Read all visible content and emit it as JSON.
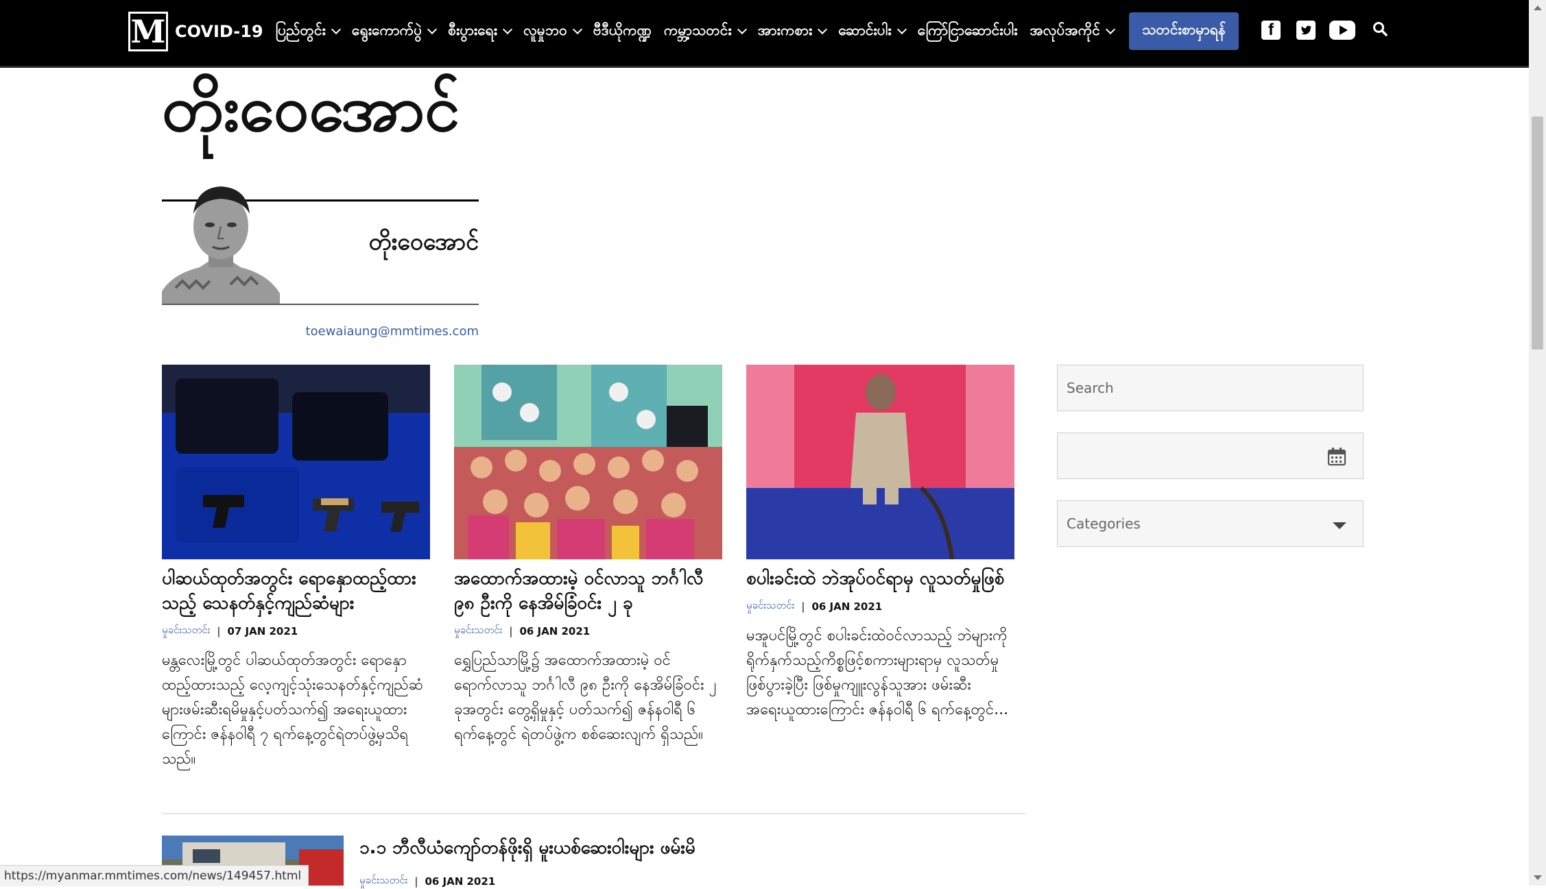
{
  "nav": {
    "logo": "M",
    "items": [
      {
        "label": "COVID-19",
        "has_dropdown": false
      },
      {
        "label": "ပြည်တွင်း",
        "has_dropdown": true
      },
      {
        "label": "ရွေးကောက်ပွဲ",
        "has_dropdown": true
      },
      {
        "label": "စီးပွားရေး",
        "has_dropdown": true
      },
      {
        "label": "လူမှုဘဝ",
        "has_dropdown": true
      },
      {
        "label": "ဗီဒီယိုကဏ္ဍ",
        "has_dropdown": false
      },
      {
        "label": "ကမ္ဘာ့သတင်း",
        "has_dropdown": true
      },
      {
        "label": "အားကစား",
        "has_dropdown": true
      },
      {
        "label": "ဆောင်းပါး",
        "has_dropdown": true
      },
      {
        "label": "ကြော်ငြာဆောင်းပါး",
        "has_dropdown": false
      },
      {
        "label": "အလုပ်အကိုင်",
        "has_dropdown": true
      }
    ],
    "subscribe_label": "သတင်းစာမှာရန်",
    "icons": [
      "facebook-icon",
      "twitter-icon",
      "youtube-icon",
      "search-icon"
    ],
    "subscribe_color": "#3a5ca8"
  },
  "author": {
    "title": "တိုးဝေအောင်",
    "name": "တိုးဝေအောင်",
    "email": "toewaiaung@mmtimes.com"
  },
  "articles": [
    {
      "title": "ပါဆယ်ထုတ်အတွင်း ရောနှောထည့်ထားသည့် သေနတ်နှင့်ကျည်ဆံများ",
      "category": "မှုခင်းသတင်း",
      "date": "07 JAN 2021",
      "excerpt": "မန္တလေးမြို့တွင် ပါဆယ်ထုတ်အတွင်း ရောနှောထည့်ထားသည့် လေ့ကျင့်သုံးသေနတ်နှင့်ကျည်ဆံများဖမ်းဆီးရမိမှုနှင့်ပတ်သက်၍ အရေးယူထားကြောင်း ဇန်နဝါရီ ၇ ရက်နေ့တွင်ရဲတပ်ဖွဲ့မှသိရသည်။"
    },
    {
      "title": "အထောက်အထားမဲ့ ဝင်လာသူ ဘင်္ဂါလီ ၉၈ ဦးကို နေအိမ်ခြံဝင်း ၂ ခု",
      "category": "မှုခင်းသတင်း",
      "date": "06 JAN 2021",
      "excerpt": "ရွှေပြည်သာမြို့၌ အထောက်အထားမဲ့ ဝင်ရောက်လာသူ ဘင်္ဂါလီ ၉၈ ဦးကို နေအိမ်ခြံဝင်း ၂ ခုအတွင်း တွေ့ရှိမှုနှင့် ပတ်သက်၍ ဇန်နဝါရီ ၆ ရက်နေ့တွင် ရဲတပ်ဖွဲ့က စစ်ဆေးလျက် ရှိသည်။"
    },
    {
      "title": "စပါးခင်းထဲ ဘဲအုပ်ဝင်ရာမှ လူသတ်မှုဖြစ်",
      "category": "မှုခင်းသတင်း",
      "date": "06 JAN 2021",
      "excerpt": "မအူပင်မြို့တွင် စပါးခင်းထဲဝင်လာသည့် ဘဲများကို ရိုက်နှက်သည့်ကိစ္စဖြင့်စကားများရာမှ လူသတ်မှုဖြစ်ပွားခဲ့ပြီး ဖြစ်မှုကျူးလွန်သူအား ဖမ်းဆီးအရေးယူထားကြောင်း ဇန်နဝါရီ ၆ ရက်နေ့တွင်..."
    }
  ],
  "row_article": {
    "title": "၁.၁ ဘီလီယံကျော်တန်ဖိုးရှိ မူးယစ်ဆေးဝါးများ ဖမ်းမိ",
    "category": "မှုခင်းသတင်း",
    "date": "06 JAN 2021"
  },
  "meta_separator": "|",
  "sidebar": {
    "search_placeholder": "Search",
    "date_value": "",
    "categories_label": "Categories"
  },
  "status_url": "https://myanmar.mmtimes.com/news/149457.html"
}
